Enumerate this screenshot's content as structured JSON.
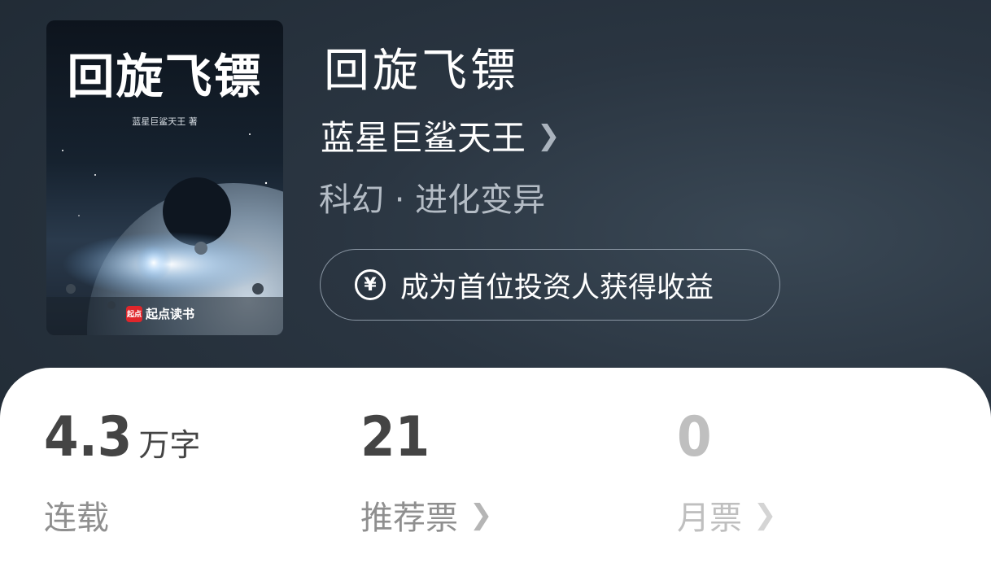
{
  "book": {
    "cover_title": "回旋飞镖",
    "cover_author": "蓝星巨鲨天王 著",
    "cover_brand": "起点读书",
    "cover_brand_mark": "起点",
    "title": "回旋飞镖",
    "author": "蓝星巨鲨天王",
    "genre": "科幻 · 进化变异"
  },
  "invest": {
    "icon": "yen-circle-icon",
    "label": "成为首位投资人获得收益"
  },
  "stats": {
    "words": {
      "value": "4.3",
      "unit": "万字",
      "label": "连载"
    },
    "recommend": {
      "value": "21",
      "label": "推荐票"
    },
    "monthly": {
      "value": "0",
      "label": "月票"
    }
  },
  "colors": {
    "background": "#2a3541",
    "panel": "#ffffff",
    "brand_red": "#e0262b"
  }
}
